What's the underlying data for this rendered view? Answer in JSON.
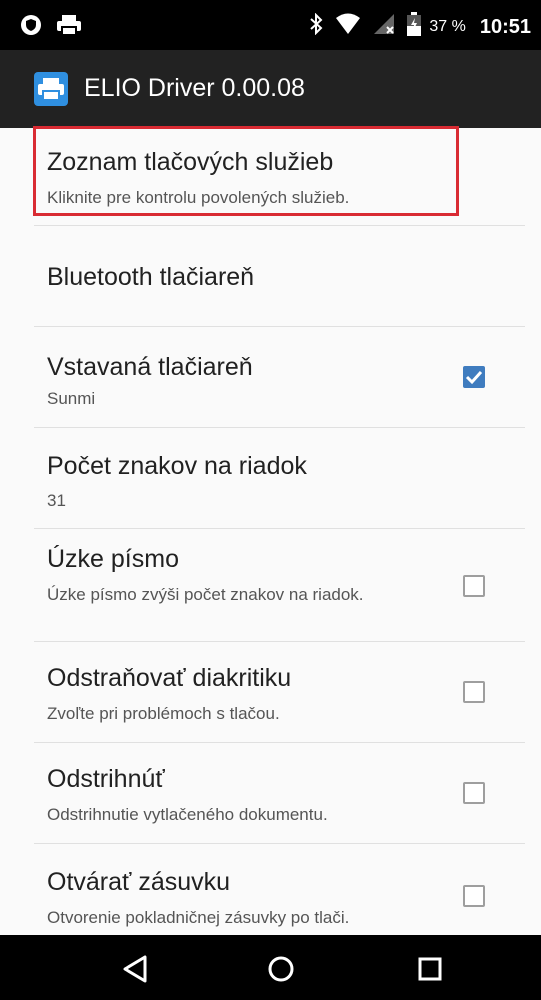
{
  "status_bar": {
    "battery_percent": "37 %",
    "time": "10:51",
    "icons": [
      "vpn-shield-icon",
      "printer-icon",
      "bluetooth-icon",
      "wifi-icon",
      "no-signal-icon",
      "battery-icon"
    ]
  },
  "app_bar": {
    "title": "ELIO Driver 0.00.08",
    "icon": "printer-icon"
  },
  "preferences": [
    {
      "title": "Zoznam tlačových služieb",
      "summary": "Kliknite pre kontrolu povolených služieb.",
      "checkbox": null,
      "highlighted": true
    },
    {
      "title": "Bluetooth tlačiareň",
      "summary": "",
      "checkbox": null
    },
    {
      "title": "Vstavaná tlačiareň",
      "summary": "Sunmi",
      "checkbox": true
    },
    {
      "title": "Počet znakov na riadok",
      "summary": "31",
      "checkbox": null
    },
    {
      "title": "Úzke písmo",
      "summary": "Úzke písmo zvýši počet znakov na riadok.",
      "checkbox": false
    },
    {
      "title": "Odstraňovať diakritiku",
      "summary": "Zvoľte pri problémoch s tlačou.",
      "checkbox": false
    },
    {
      "title": "Odstrihnúť",
      "summary": "Odstrihnutie vytlačeného dokumentu.",
      "checkbox": false
    },
    {
      "title": "Otvárať zásuvku",
      "summary": "Otvorenie pokladničnej zásuvky po tlači.",
      "checkbox": false
    }
  ],
  "nav_bar": {
    "buttons": [
      "back-icon",
      "home-icon",
      "recents-icon"
    ]
  },
  "colors": {
    "highlight_border": "#d92b33",
    "checkbox_checked": "#3f7cbf",
    "app_icon": "#2f8fe0"
  }
}
